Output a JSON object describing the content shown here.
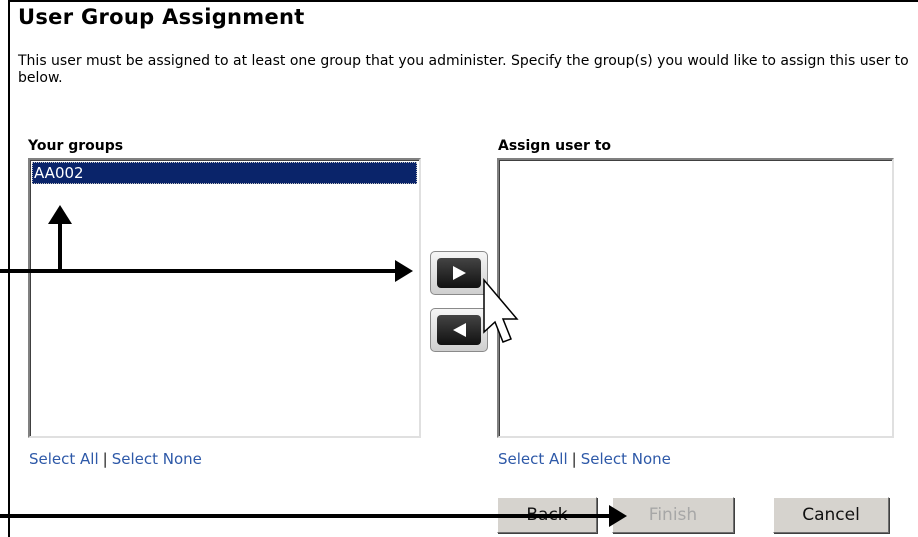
{
  "dialog": {
    "title": "User Group Assignment",
    "description": "This user must be assigned to at least one group that you administer. Specify the group(s) you would like to assign this user to below."
  },
  "your_groups": {
    "label": "Your groups",
    "items": [
      "AA002"
    ],
    "selected": "AA002",
    "select_all": "Select All",
    "select_none": "Select None",
    "separator": "|"
  },
  "assign_user_to": {
    "label": "Assign user to",
    "items": [],
    "select_all": "Select All",
    "select_none": "Select None",
    "separator": "|"
  },
  "move_buttons": {
    "add_icon": "triangle-right-icon",
    "remove_icon": "triangle-left-icon"
  },
  "footer": {
    "back_label": "Back",
    "finish_label": "Finish",
    "cancel_label": "Cancel",
    "finish_disabled": true
  },
  "colors": {
    "selection": "#0a246a",
    "link": "#2e59a8",
    "button_face": "#d6d3ce",
    "disabled_text": "#a7a7a7"
  }
}
